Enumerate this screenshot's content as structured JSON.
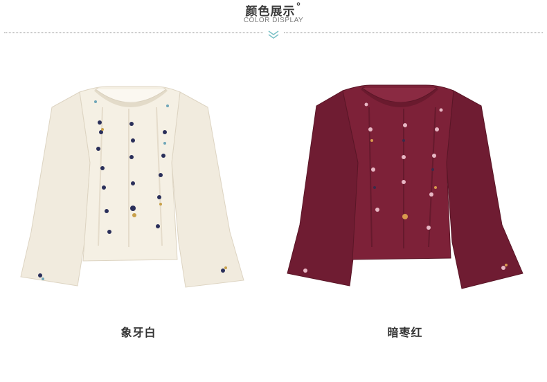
{
  "header": {
    "title": "颜色展示",
    "title_mark": "°",
    "subtitle": "COLOR DISPLAY"
  },
  "colors": {
    "accent_chevron": "#7ec3c8",
    "ivory": "#f4efe3",
    "wine": "#7d2138"
  },
  "products": [
    {
      "label": "象牙白",
      "color": "#f4efe3"
    },
    {
      "label": "暗枣红",
      "color": "#7d2138"
    }
  ]
}
